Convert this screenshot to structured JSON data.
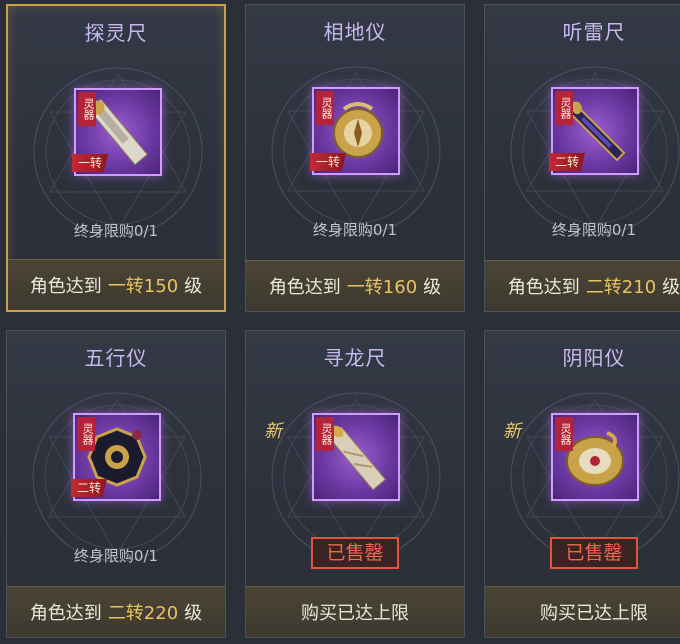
{
  "cards": [
    {
      "title": "探灵尺",
      "tag": "灵器",
      "tier": "一转",
      "limit": "终身限购0/1",
      "req_prefix": "角色达到",
      "req_level": "一转150",
      "req_suffix": "级"
    },
    {
      "title": "相地仪",
      "tag": "灵器",
      "tier": "一转",
      "limit": "终身限购0/1",
      "req_prefix": "角色达到",
      "req_level": "一转160",
      "req_suffix": "级"
    },
    {
      "title": "听雷尺",
      "tag": "灵器",
      "tier": "二转",
      "limit": "终身限购0/1",
      "req_prefix": "角色达到",
      "req_level": "二转210",
      "req_suffix": "级"
    },
    {
      "title": "五行仪",
      "tag": "灵器",
      "tier": "二转",
      "limit": "终身限购0/1",
      "req_prefix": "角色达到",
      "req_level": "二转220",
      "req_suffix": "级"
    },
    {
      "title": "寻龙尺",
      "tag": "灵器",
      "new_badge": "新",
      "sold": "已售罄",
      "status": "购买已达上限"
    },
    {
      "title": "阴阳仪",
      "tag": "灵器",
      "new_badge": "新",
      "sold": "已售罄",
      "status": "购买已达上限"
    }
  ],
  "colors": {
    "accent_gold": "#e8c35e",
    "title_purple": "#c8b7f0",
    "sold_red": "#f0694d",
    "frame_purple": "#d29bff"
  },
  "icons": [
    "ruler-artifact-icon",
    "compass-artifact-icon",
    "thunder-ruler-icon",
    "bagua-artifact-icon",
    "dragon-ruler-icon",
    "yinyang-compass-icon"
  ]
}
